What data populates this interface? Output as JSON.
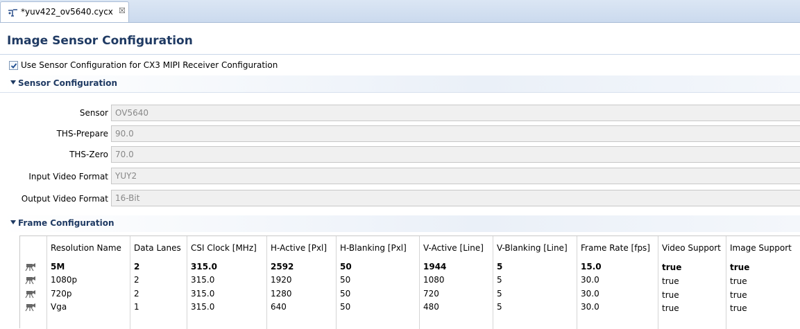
{
  "tab": {
    "label": "*yuv422_ov5640.cycx",
    "close": "☒"
  },
  "title": "Image Sensor Configuration",
  "use_sensor_checkbox": {
    "checked": true,
    "label": "Use Sensor Configuration for CX3 MIPI Receiver Configuration"
  },
  "sensor_section": {
    "title": "Sensor Configuration",
    "fields": [
      {
        "label": "Sensor",
        "value": "OV5640"
      },
      {
        "label": "THS-Prepare",
        "value": "90.0"
      },
      {
        "label": "THS-Zero",
        "value": "70.0"
      },
      {
        "label": "Input Video Format",
        "value": "YUY2"
      },
      {
        "label": "Output Video Format",
        "value": "16-Bit"
      }
    ]
  },
  "frame_section": {
    "title": "Frame Configuration",
    "headers": [
      "Resolution Name",
      "Data Lanes",
      "CSI Clock [MHz]",
      "H-Active [Pxl]",
      "H-Blanking [Pxl]",
      "V-Active [Line]",
      "V-Blanking [Line]",
      "Frame Rate [fps]",
      "Video Support",
      "Image Support"
    ],
    "rows": [
      [
        "5M",
        "2",
        "315.0",
        "2592",
        "50",
        "1944",
        "5",
        "15.0",
        "true",
        "true"
      ],
      [
        "1080p",
        "2",
        "315.0",
        "1920",
        "50",
        "1080",
        "5",
        "30.0",
        "true",
        "true"
      ],
      [
        "720p",
        "2",
        "315.0",
        "1280",
        "50",
        "720",
        "5",
        "30.0",
        "true",
        "true"
      ],
      [
        "Vga",
        "1",
        "315.0",
        "640",
        "50",
        "480",
        "5",
        "30.0",
        "true",
        "true"
      ]
    ],
    "selected_row": 0
  }
}
